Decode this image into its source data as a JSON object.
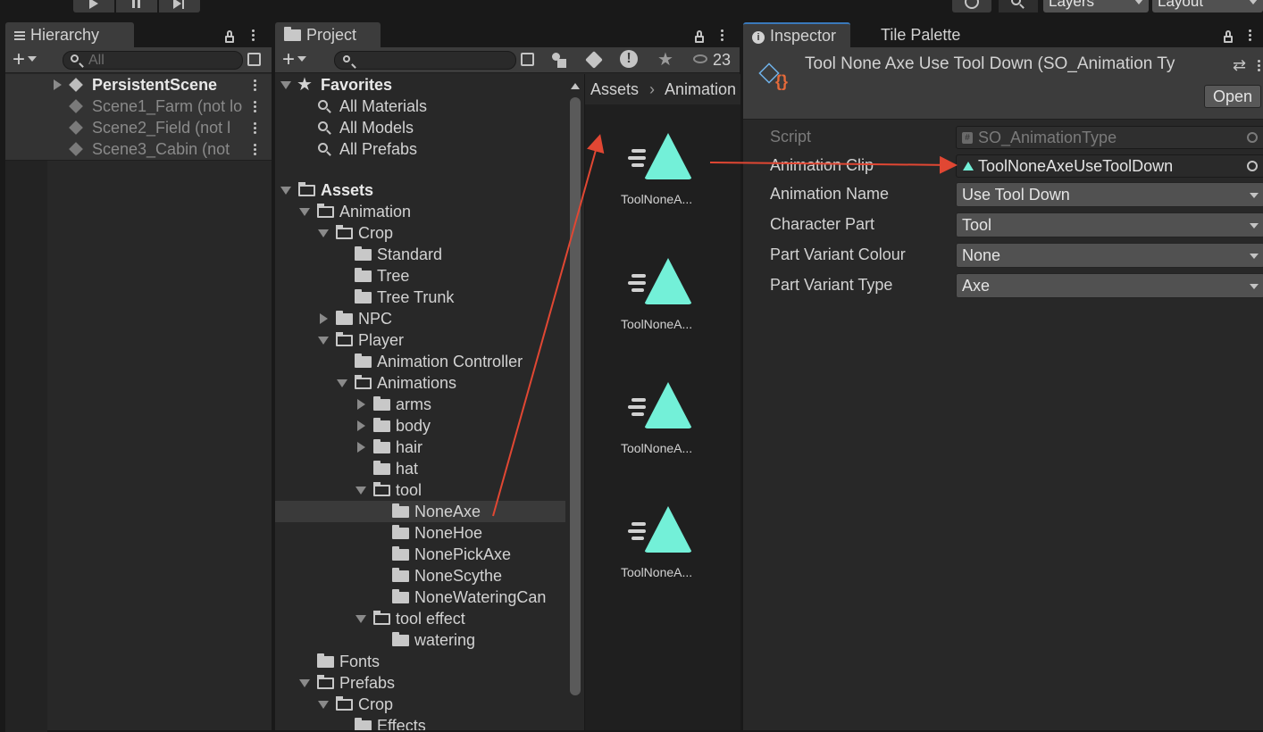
{
  "colors": {
    "accent_teal": "#73f0d8",
    "arrow_red": "#e14733",
    "selected_row": "#3a3a3a"
  },
  "toolbar": {
    "layers_label": "Layers",
    "layout_label": "Layout"
  },
  "hierarchy": {
    "tab_label": "Hierarchy",
    "search_placeholder": "All",
    "scenes": [
      "PersistentScene",
      "Scene1_Farm (not lo",
      "Scene2_Field (not l",
      "Scene3_Cabin (not"
    ]
  },
  "project": {
    "tab_label": "Project",
    "hidden_count": "23",
    "favorites": {
      "label": "Favorites",
      "items": [
        "All Materials",
        "All Models",
        "All Prefabs"
      ]
    },
    "tree": [
      {
        "label": "Assets"
      },
      {
        "label": "Animation"
      },
      {
        "label": "Crop"
      },
      {
        "label": "Standard"
      },
      {
        "label": "Tree"
      },
      {
        "label": "Tree Trunk"
      },
      {
        "label": "NPC"
      },
      {
        "label": "Player"
      },
      {
        "label": "Animation Controller"
      },
      {
        "label": "Animations"
      },
      {
        "label": "arms"
      },
      {
        "label": "body"
      },
      {
        "label": "hair"
      },
      {
        "label": "hat"
      },
      {
        "label": "tool"
      },
      {
        "label": "NoneAxe"
      },
      {
        "label": "NoneHoe"
      },
      {
        "label": "NonePickAxe"
      },
      {
        "label": "NoneScythe"
      },
      {
        "label": "NoneWateringCan"
      },
      {
        "label": "tool effect"
      },
      {
        "label": "watering"
      },
      {
        "label": "Fonts"
      },
      {
        "label": "Prefabs"
      },
      {
        "label": "Crop"
      },
      {
        "label": "Effects"
      }
    ],
    "breadcrumb": {
      "root": "Assets",
      "current": "Animation"
    },
    "assets": [
      "ToolNoneA...",
      "ToolNoneA...",
      "ToolNoneA...",
      "ToolNoneA..."
    ]
  },
  "inspector": {
    "tab_label": "Inspector",
    "tab2_label": "Tile Palette",
    "title": "Tool None Axe Use Tool Down (SO_Animation Ty",
    "open_label": "Open",
    "fields": {
      "script_label": "Script",
      "script_value": "SO_AnimationType",
      "clip_label": "Animation Clip",
      "clip_value": "ToolNoneAxeUseToolDown",
      "name_label": "Animation Name",
      "name_value": "Use Tool Down",
      "part_label": "Character Part",
      "part_value": "Tool",
      "colour_label": "Part Variant Colour",
      "colour_value": "None",
      "type_label": "Part Variant Type",
      "type_value": "Axe"
    }
  }
}
